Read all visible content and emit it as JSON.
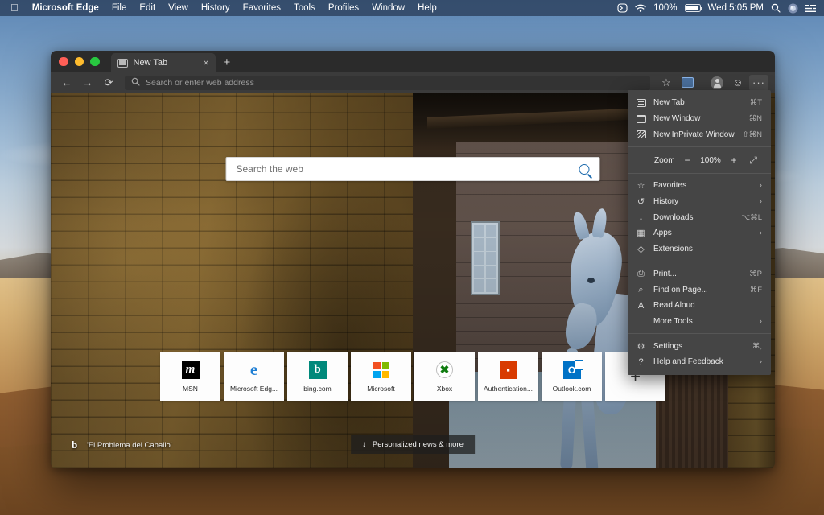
{
  "menubar": {
    "apple_icon": "apple-logo",
    "app_name": "Microsoft Edge",
    "items": [
      "File",
      "Edit",
      "View",
      "History",
      "Favorites",
      "Tools",
      "Profiles",
      "Window",
      "Help"
    ],
    "status": {
      "shortcuts_icon": "shortcuts-icon",
      "wifi_icon": "wifi-icon",
      "battery_percent": "100%",
      "battery_icon": "battery-icon",
      "clock": "Wed 5:05 PM",
      "search_icon": "spotlight-search-icon",
      "siri_icon": "siri-icon",
      "control_center_icon": "control-center-icon"
    }
  },
  "browser": {
    "traffic_lights": [
      "close",
      "minimize",
      "zoom"
    ],
    "tab": {
      "title": "New Tab",
      "favicon": "page-favicon",
      "close_icon": "×"
    },
    "new_tab_button": "+",
    "toolbar": {
      "back_icon": "←",
      "forward_icon": "→",
      "reload_icon": "⟳",
      "address_placeholder": "Search or enter web address",
      "address_value": "",
      "search_icon": "search-icon",
      "favorite_icon": "☆",
      "collections_icon": "collections-icon",
      "profile_icon": "profile-avatar-icon",
      "feedback_icon": "☺",
      "more_icon": "···"
    }
  },
  "newtab": {
    "search": {
      "placeholder": "Search the web",
      "value": "",
      "submit_icon": "search-icon"
    },
    "tiles": [
      {
        "label": "MSN",
        "icon": "msn-icon",
        "glyph": "m"
      },
      {
        "label": "Microsoft Edg...",
        "icon": "edge-icon",
        "glyph": "e"
      },
      {
        "label": "bing.com",
        "icon": "bing-icon",
        "glyph": "b"
      },
      {
        "label": "Microsoft",
        "icon": "microsoft-icon",
        "glyph": ""
      },
      {
        "label": "Xbox",
        "icon": "xbox-icon",
        "glyph": "✖"
      },
      {
        "label": "Authentication...",
        "icon": "office-icon",
        "glyph": "◨"
      },
      {
        "label": "Outlook.com",
        "icon": "outlook-icon",
        "glyph": "O"
      }
    ],
    "add_tile_label": "+",
    "image_credit": {
      "bing_icon": "bing-logo",
      "text": "'El Problema del Caballo'"
    },
    "news_pill": {
      "icon": "↓",
      "label": "Personalized news & more"
    }
  },
  "edge_menu": {
    "groups": [
      [
        {
          "icon": "new-tab-icon",
          "label": "New Tab",
          "shortcut": "⌘T",
          "arrow": ""
        },
        {
          "icon": "new-window-icon",
          "label": "New Window",
          "shortcut": "⌘N",
          "arrow": ""
        },
        {
          "icon": "inprivate-icon",
          "label": "New InPrivate Window",
          "shortcut": "⇧⌘N",
          "arrow": ""
        }
      ],
      [
        {
          "icon": "star-icon",
          "label": "Favorites",
          "shortcut": "",
          "arrow": "›"
        },
        {
          "icon": "history-icon",
          "label": "History",
          "shortcut": "",
          "arrow": "›"
        },
        {
          "icon": "download-icon",
          "label": "Downloads",
          "shortcut": "⌥⌘L",
          "arrow": ""
        },
        {
          "icon": "apps-icon",
          "label": "Apps",
          "shortcut": "",
          "arrow": "›"
        },
        {
          "icon": "extensions-icon",
          "label": "Extensions",
          "shortcut": "",
          "arrow": ""
        }
      ],
      [
        {
          "icon": "print-icon",
          "label": "Print...",
          "shortcut": "⌘P",
          "arrow": ""
        },
        {
          "icon": "find-icon",
          "label": "Find on Page...",
          "shortcut": "⌘F",
          "arrow": ""
        },
        {
          "icon": "read-aloud-icon",
          "label": "Read Aloud",
          "shortcut": "",
          "arrow": ""
        },
        {
          "icon": "",
          "label": "More Tools",
          "shortcut": "",
          "arrow": "›"
        }
      ],
      [
        {
          "icon": "gear-icon",
          "label": "Settings",
          "shortcut": "⌘,",
          "arrow": ""
        },
        {
          "icon": "help-icon",
          "label": "Help and Feedback",
          "shortcut": "",
          "arrow": "›"
        }
      ]
    ],
    "zoom": {
      "label": "Zoom",
      "minus": "−",
      "value": "100%",
      "plus": "+",
      "fullscreen_icon": "⤢"
    }
  },
  "colors": {
    "menu_bg": "#454545",
    "toolbar_bg": "#3b3b3b",
    "tabstrip_bg": "#2b2b2b",
    "accent_blue": "#1b6aad"
  }
}
